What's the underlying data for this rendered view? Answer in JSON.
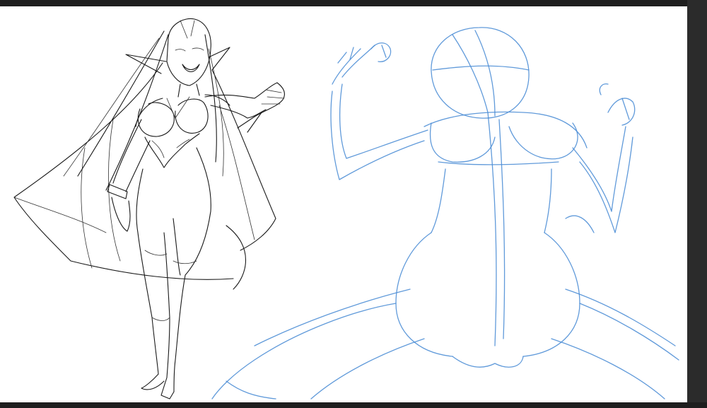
{
  "app": {
    "colors": {
      "frame": "#2b2b2b",
      "frame_dark": "#1e1e1e",
      "canvas": "#ffffff",
      "ink": "#1a1a1a",
      "sketch_blue": "#4f8fd6"
    }
  },
  "canvas": {
    "layers": [
      {
        "name": "lineart",
        "color": "#1a1a1a"
      },
      {
        "name": "blue-gesture-sketch",
        "color": "#4f8fd6"
      }
    ]
  }
}
